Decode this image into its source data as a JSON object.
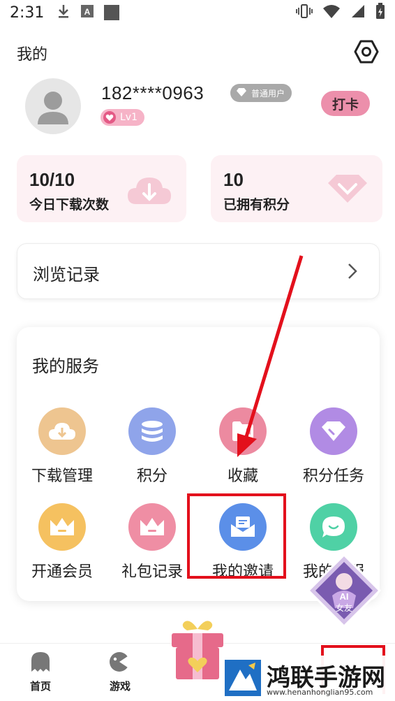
{
  "status_bar": {
    "time": "2:31",
    "icons": [
      "download-icon",
      "app-a-icon",
      "square-icon",
      "vibrate-icon",
      "wifi-icon",
      "signal-icon",
      "battery-icon"
    ]
  },
  "header": {
    "title": "我的",
    "settings_icon": "hexagon-settings-icon"
  },
  "profile": {
    "phone": "182****0963",
    "user_type": "普通用户",
    "level": "Lv1",
    "checkin_label": "打卡"
  },
  "stats": {
    "downloads": {
      "value": "10/10",
      "label": "今日下载次数"
    },
    "points": {
      "value": "10",
      "label": "已拥有积分"
    }
  },
  "browse": {
    "label": "浏览记录"
  },
  "services": {
    "title": "我的服务",
    "items": [
      {
        "label": "下载管理",
        "color": "#eec590",
        "icon": "cloud-download-icon"
      },
      {
        "label": "积分",
        "color": "#8fa4ea",
        "icon": "coin-stack-icon"
      },
      {
        "label": "收藏",
        "color": "#ec8aa0",
        "icon": "favorite-folder-icon"
      },
      {
        "label": "积分任务",
        "color": "#b18be4",
        "icon": "diamond-task-icon"
      },
      {
        "label": "开通会员",
        "color": "#f5c160",
        "icon": "crown-icon"
      },
      {
        "label": "礼包记录",
        "color": "#ef8ea4",
        "icon": "basket-icon"
      },
      {
        "label": "我的邀请",
        "color": "#5b8fe8",
        "icon": "envelope-icon"
      },
      {
        "label": "我的客服",
        "color": "#4fd1a5",
        "icon": "chat-bubble-icon"
      }
    ]
  },
  "ai_badge": {
    "line1": "AI",
    "line2": "女友"
  },
  "tabbar": {
    "items": [
      {
        "label": "首页",
        "icon": "ghost-icon"
      },
      {
        "label": "游戏",
        "icon": "gamepad-icon"
      }
    ],
    "center_icon": "gift-box-icon"
  },
  "watermark": {
    "text": "鸿联手游网",
    "url": "www.henanhonglian95.com"
  }
}
